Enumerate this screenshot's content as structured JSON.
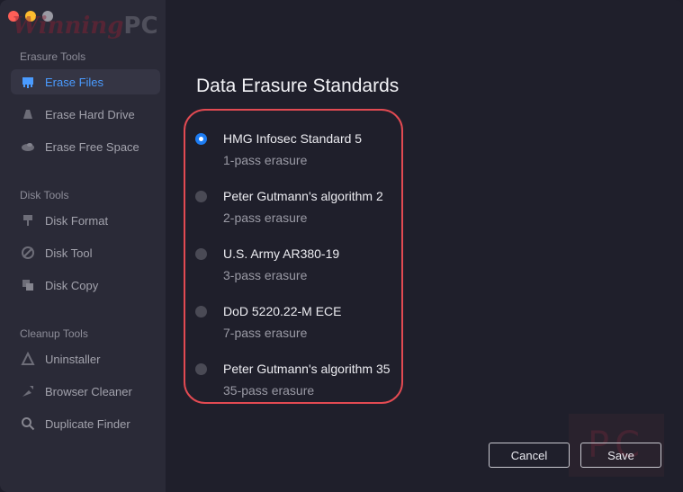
{
  "window": {
    "traffic_lights": [
      "close",
      "minimize",
      "zoom"
    ]
  },
  "watermark": {
    "logo_script": "Winning",
    "logo_pc": "PC",
    "corner_pc": "PC"
  },
  "sidebar": {
    "sections": [
      {
        "title": "Erasure Tools",
        "items": [
          {
            "label": "Erase Files",
            "icon": "erase-files-icon",
            "active": true
          },
          {
            "label": "Erase Hard Drive",
            "icon": "hard-drive-icon"
          },
          {
            "label": "Erase Free Space",
            "icon": "free-space-icon"
          }
        ]
      },
      {
        "title": "Disk Tools",
        "items": [
          {
            "label": "Disk Format",
            "icon": "disk-format-icon"
          },
          {
            "label": "Disk Tool",
            "icon": "disk-tool-icon"
          },
          {
            "label": "Disk Copy",
            "icon": "disk-copy-icon"
          }
        ]
      },
      {
        "title": "Cleanup Tools",
        "items": [
          {
            "label": "Uninstaller",
            "icon": "uninstaller-icon"
          },
          {
            "label": "Browser Cleaner",
            "icon": "browser-cleaner-icon"
          },
          {
            "label": "Duplicate Finder",
            "icon": "search-icon"
          }
        ]
      }
    ]
  },
  "main": {
    "title": "Data Erasure Standards",
    "options": [
      {
        "label": "HMG Infosec Standard 5",
        "sub": "1-pass erasure",
        "checked": true
      },
      {
        "label": "Peter Gutmann's algorithm 2",
        "sub": "2-pass erasure",
        "checked": false
      },
      {
        "label": "U.S. Army AR380-19",
        "sub": "3-pass erasure",
        "checked": false
      },
      {
        "label": "DoD 5220.22-M ECE",
        "sub": "7-pass erasure",
        "checked": false
      },
      {
        "label": "Peter Gutmann's algorithm 35",
        "sub": "35-pass erasure",
        "checked": false
      }
    ],
    "cancel_label": "Cancel",
    "save_label": "Save"
  },
  "colors": {
    "accent": "#1d7cf2",
    "highlight_border": "#e24a52",
    "active_text": "#4a9bff"
  }
}
